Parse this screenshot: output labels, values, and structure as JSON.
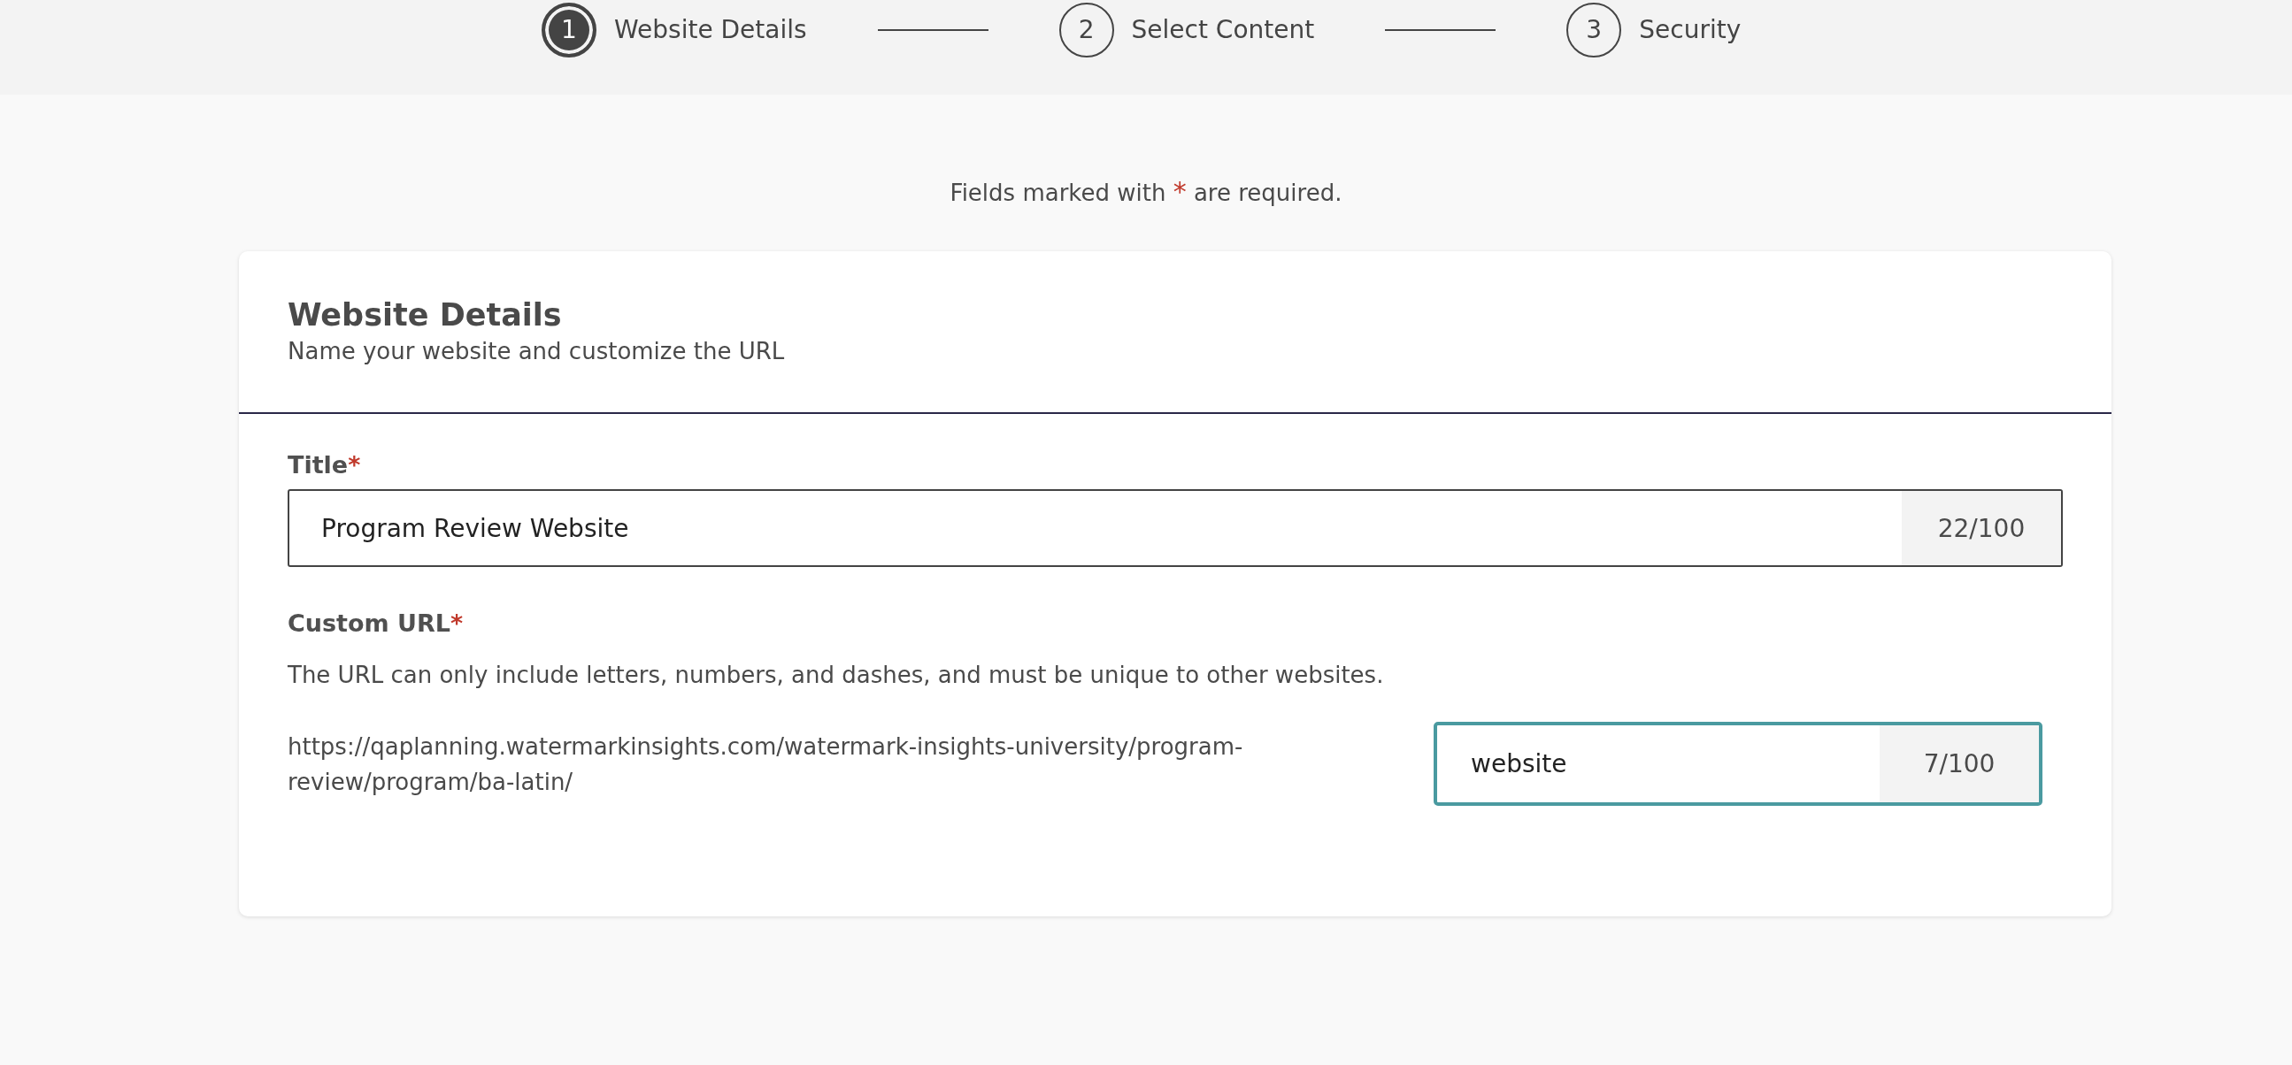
{
  "stepper": {
    "steps": [
      {
        "number": "1",
        "label": "Website Details",
        "selected": true
      },
      {
        "number": "2",
        "label": "Select Content",
        "selected": false
      },
      {
        "number": "3",
        "label": "Security",
        "selected": false
      }
    ]
  },
  "required_note": {
    "before": "Fields marked with",
    "mark": "*",
    "after": "are required."
  },
  "card": {
    "title": "Website Details",
    "subtitle": "Name your website and customize the URL",
    "title_field": {
      "label": "Title",
      "required_mark": "*",
      "value": "Program Review Website",
      "counter": "22/100",
      "focused": false
    },
    "url_field": {
      "label": "Custom URL",
      "required_mark": "*",
      "help": "The URL can only include letters, numbers, and dashes, and must be unique to other websites.",
      "prefix": "https://qaplanning.watermarkinsights.com/watermark-insights-university/program-review/program/ba-latin/",
      "value": "website",
      "counter": "7/100",
      "focused": true
    }
  }
}
